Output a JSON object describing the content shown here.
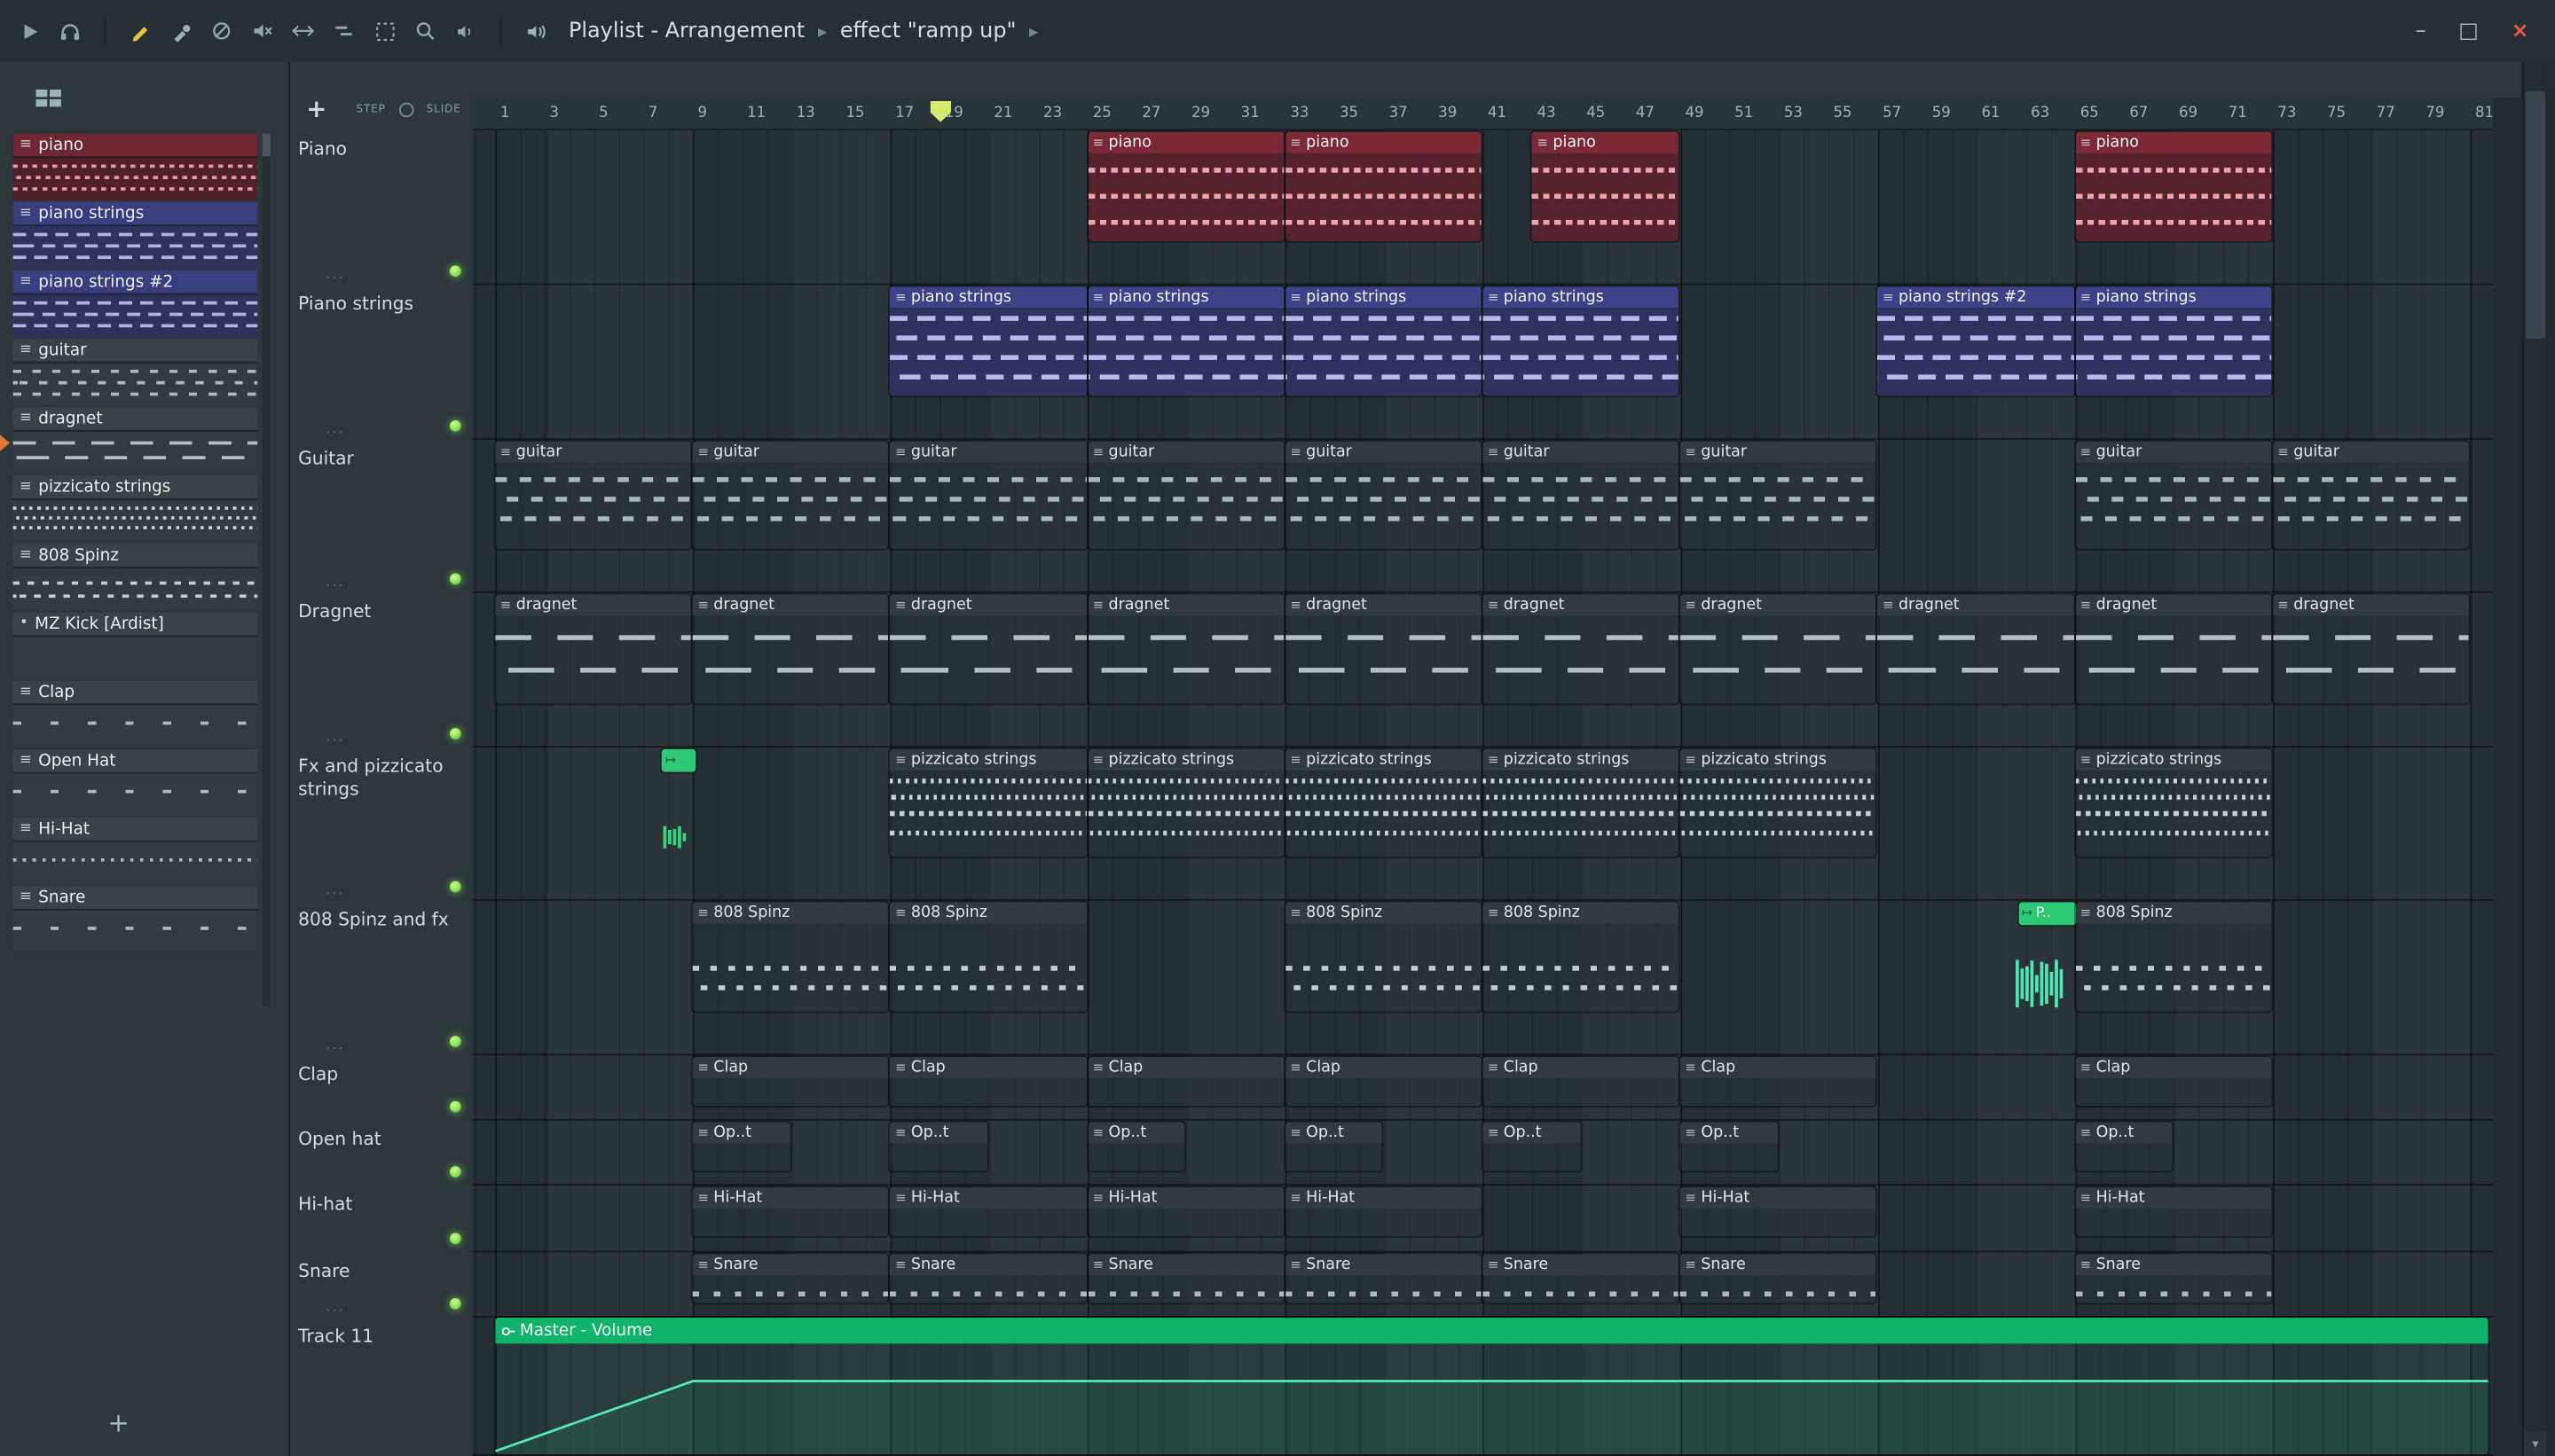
{
  "titlebar": {
    "breadcrumb": [
      "Playlist - Arrangement",
      "effect \"ramp up\""
    ],
    "window": {
      "minimize": "–",
      "maximize": "□",
      "close": "×"
    }
  },
  "playlist_controls": {
    "step_label": "STEP",
    "slide_label": "SLIDE",
    "add_label": "+"
  },
  "sidebar": {
    "add_label": "+",
    "items": [
      {
        "label": "piano",
        "color": "red",
        "preview": "p-piano"
      },
      {
        "label": "piano strings",
        "color": "indigo",
        "preview": "p-strings"
      },
      {
        "label": "piano strings #2",
        "color": "indigo",
        "preview": "p-strings"
      },
      {
        "label": "guitar",
        "color": "gray",
        "preview": "p-guitar"
      },
      {
        "label": "dragnet",
        "color": "gray",
        "preview": "p-dragnet",
        "playing": true
      },
      {
        "label": "pizzicato strings",
        "color": "gray",
        "preview": "p-pizz"
      },
      {
        "label": "808 Spinz",
        "color": "gray",
        "preview": "p-808"
      },
      {
        "label": "MZ Kick [Ardist]",
        "color": "gray",
        "preview": "p-empty",
        "bullet": true
      },
      {
        "label": "Clap",
        "color": "gray",
        "preview": "p-sparse"
      },
      {
        "label": "Open Hat",
        "color": "gray",
        "preview": "p-sparse"
      },
      {
        "label": "Hi-Hat",
        "color": "gray",
        "preview": "p-dots"
      },
      {
        "label": "Snare",
        "color": "gray",
        "preview": "p-sparse"
      }
    ]
  },
  "ruler": {
    "start": 1,
    "end": 81,
    "step": 2,
    "playhead_bar": 19
  },
  "tracks": [
    {
      "name": "Piano",
      "dots": true,
      "led": true
    },
    {
      "name": "Piano strings",
      "dots": true,
      "led": true
    },
    {
      "name": "Guitar",
      "dots": true,
      "led": true
    },
    {
      "name": "Dragnet",
      "dots": true,
      "led": true
    },
    {
      "name": "Fx and pizzicato strings",
      "dots": true,
      "led": true
    },
    {
      "name": "808 Spinz and fx",
      "dots": true,
      "led": true
    },
    {
      "name": "Clap",
      "dots": false,
      "led": true
    },
    {
      "name": "Open hat",
      "dots": false,
      "led": true
    },
    {
      "name": "Hi-hat",
      "dots": false,
      "led": true
    },
    {
      "name": "Snare",
      "dots": true,
      "led": true
    },
    {
      "name": "Track 11",
      "dots": false,
      "led": false
    }
  ],
  "clips": [
    {
      "t": 0,
      "s": 25,
      "e": 33,
      "k": "piano",
      "label": "piano"
    },
    {
      "t": 0,
      "s": 33,
      "e": 41,
      "k": "piano",
      "label": "piano"
    },
    {
      "t": 0,
      "s": 43,
      "e": 49,
      "k": "piano",
      "label": "piano"
    },
    {
      "t": 0,
      "s": 65,
      "e": 73,
      "k": "piano",
      "label": "piano"
    },
    {
      "t": 1,
      "s": 17,
      "e": 25,
      "k": "strings",
      "label": "piano strings"
    },
    {
      "t": 1,
      "s": 25,
      "e": 33,
      "k": "strings",
      "label": "piano strings"
    },
    {
      "t": 1,
      "s": 33,
      "e": 41,
      "k": "strings",
      "label": "piano strings"
    },
    {
      "t": 1,
      "s": 41,
      "e": 49,
      "k": "strings",
      "label": "piano strings"
    },
    {
      "t": 1,
      "s": 57,
      "e": 65,
      "k": "strings",
      "label": "piano strings #2"
    },
    {
      "t": 1,
      "s": 65,
      "e": 73,
      "k": "strings",
      "label": "piano strings"
    },
    {
      "t": 2,
      "s": 1,
      "e": 9,
      "k": "guitar",
      "label": "guitar"
    },
    {
      "t": 2,
      "s": 9,
      "e": 17,
      "k": "guitar",
      "label": "guitar"
    },
    {
      "t": 2,
      "s": 17,
      "e": 25,
      "k": "guitar",
      "label": "guitar"
    },
    {
      "t": 2,
      "s": 25,
      "e": 33,
      "k": "guitar",
      "label": "guitar"
    },
    {
      "t": 2,
      "s": 33,
      "e": 41,
      "k": "guitar",
      "label": "guitar"
    },
    {
      "t": 2,
      "s": 41,
      "e": 49,
      "k": "guitar",
      "label": "guitar"
    },
    {
      "t": 2,
      "s": 49,
      "e": 57,
      "k": "guitar",
      "label": "guitar"
    },
    {
      "t": 2,
      "s": 65,
      "e": 73,
      "k": "guitar",
      "label": "guitar"
    },
    {
      "t": 2,
      "s": 73,
      "e": 81,
      "k": "guitar",
      "label": "guitar"
    },
    {
      "t": 3,
      "s": 1,
      "e": 9,
      "k": "dragnet",
      "label": "dragnet"
    },
    {
      "t": 3,
      "s": 9,
      "e": 17,
      "k": "dragnet",
      "label": "dragnet"
    },
    {
      "t": 3,
      "s": 17,
      "e": 25,
      "k": "dragnet",
      "label": "dragnet"
    },
    {
      "t": 3,
      "s": 25,
      "e": 33,
      "k": "dragnet",
      "label": "dragnet"
    },
    {
      "t": 3,
      "s": 33,
      "e": 41,
      "k": "dragnet",
      "label": "dragnet"
    },
    {
      "t": 3,
      "s": 41,
      "e": 49,
      "k": "dragnet",
      "label": "dragnet"
    },
    {
      "t": 3,
      "s": 49,
      "e": 57,
      "k": "dragnet",
      "label": "dragnet"
    },
    {
      "t": 3,
      "s": 57,
      "e": 65,
      "k": "dragnet",
      "label": "dragnet"
    },
    {
      "t": 3,
      "s": 65,
      "e": 73,
      "k": "dragnet",
      "label": "dragnet"
    },
    {
      "t": 3,
      "s": 73,
      "e": 81,
      "k": "dragnet",
      "label": "dragnet"
    },
    {
      "t": 4,
      "s": 7.75,
      "e": 8.9,
      "k": "fxclip",
      "label": ""
    },
    {
      "t": 4,
      "s": 7.75,
      "e": 8.9,
      "k": "fxwave",
      "label": ""
    },
    {
      "t": 4,
      "s": 17,
      "e": 25,
      "k": "pizz",
      "label": "pizzicato strings"
    },
    {
      "t": 4,
      "s": 25,
      "e": 33,
      "k": "pizz",
      "label": "pizzicato strings"
    },
    {
      "t": 4,
      "s": 33,
      "e": 41,
      "k": "pizz",
      "label": "pizzicato strings"
    },
    {
      "t": 4,
      "s": 41,
      "e": 49,
      "k": "pizz",
      "label": "pizzicato strings"
    },
    {
      "t": 4,
      "s": 49,
      "e": 57,
      "k": "pizz",
      "label": "pizzicato strings"
    },
    {
      "t": 4,
      "s": 65,
      "e": 73,
      "k": "pizz",
      "label": "pizzicato strings"
    },
    {
      "t": 5,
      "s": 9,
      "e": 17,
      "k": "b808",
      "label": "808 Spinz"
    },
    {
      "t": 5,
      "s": 17,
      "e": 25,
      "k": "b808",
      "label": "808 Spinz"
    },
    {
      "t": 5,
      "s": 33,
      "e": 41,
      "k": "b808",
      "label": "808 Spinz"
    },
    {
      "t": 5,
      "s": 41,
      "e": 49,
      "k": "b808",
      "label": "808 Spinz"
    },
    {
      "t": 5,
      "s": 62.7,
      "e": 64.85,
      "k": "fxclip",
      "label": "P.."
    },
    {
      "t": 5,
      "s": 62.5,
      "e": 64.6,
      "k": "wave808",
      "label": ""
    },
    {
      "t": 5,
      "s": 65,
      "e": 73,
      "k": "b808",
      "label": "808 Spinz"
    },
    {
      "t": 6,
      "s": 9,
      "e": 17,
      "k": "clap",
      "label": "Clap"
    },
    {
      "t": 6,
      "s": 17,
      "e": 25,
      "k": "clap",
      "label": "Clap"
    },
    {
      "t": 6,
      "s": 25,
      "e": 33,
      "k": "clap",
      "label": "Clap"
    },
    {
      "t": 6,
      "s": 33,
      "e": 41,
      "k": "clap",
      "label": "Clap"
    },
    {
      "t": 6,
      "s": 41,
      "e": 49,
      "k": "clap",
      "label": "Clap"
    },
    {
      "t": 6,
      "s": 49,
      "e": 57,
      "k": "clap",
      "label": "Clap"
    },
    {
      "t": 6,
      "s": 65,
      "e": 73,
      "k": "clap",
      "label": "Clap"
    },
    {
      "t": 7,
      "s": 9,
      "e": 13,
      "k": "openhat",
      "label": "Op..t"
    },
    {
      "t": 7,
      "s": 17,
      "e": 21,
      "k": "openhat",
      "label": "Op..t"
    },
    {
      "t": 7,
      "s": 25,
      "e": 29,
      "k": "openhat",
      "label": "Op..t"
    },
    {
      "t": 7,
      "s": 33,
      "e": 37,
      "k": "openhat",
      "label": "Op..t"
    },
    {
      "t": 7,
      "s": 41,
      "e": 45,
      "k": "openhat",
      "label": "Op..t"
    },
    {
      "t": 7,
      "s": 49,
      "e": 53,
      "k": "openhat",
      "label": "Op..t"
    },
    {
      "t": 7,
      "s": 65,
      "e": 69,
      "k": "openhat",
      "label": "Op..t"
    },
    {
      "t": 8,
      "s": 9,
      "e": 17,
      "k": "hihat",
      "label": "Hi-Hat"
    },
    {
      "t": 8,
      "s": 17,
      "e": 25,
      "k": "hihat",
      "label": "Hi-Hat"
    },
    {
      "t": 8,
      "s": 25,
      "e": 33,
      "k": "hihat",
      "label": "Hi-Hat"
    },
    {
      "t": 8,
      "s": 33,
      "e": 41,
      "k": "hihat",
      "label": "Hi-Hat"
    },
    {
      "t": 8,
      "s": 49,
      "e": 57,
      "k": "hihat",
      "label": "Hi-Hat"
    },
    {
      "t": 8,
      "s": 65,
      "e": 73,
      "k": "hihat",
      "label": "Hi-Hat"
    },
    {
      "t": 9,
      "s": 9,
      "e": 17,
      "k": "snare",
      "label": "Snare"
    },
    {
      "t": 9,
      "s": 17,
      "e": 25,
      "k": "snare",
      "label": "Snare"
    },
    {
      "t": 9,
      "s": 25,
      "e": 33,
      "k": "snare",
      "label": "Snare"
    },
    {
      "t": 9,
      "s": 33,
      "e": 41,
      "k": "snare",
      "label": "Snare"
    },
    {
      "t": 9,
      "s": 41,
      "e": 49,
      "k": "snare",
      "label": "Snare"
    },
    {
      "t": 9,
      "s": 49,
      "e": 57,
      "k": "snare",
      "label": "Snare"
    },
    {
      "t": 9,
      "s": 65,
      "e": 73,
      "k": "snare",
      "label": "Snare"
    },
    {
      "t": 10,
      "s": 1,
      "e": 81.8,
      "k": "auto",
      "label": "Master - Volume"
    }
  ],
  "automation": {
    "label": "Master - Volume",
    "points": [
      {
        "bar": 1,
        "level": 0
      },
      {
        "bar": 9,
        "level": 1
      },
      {
        "bar": 82,
        "level": 1
      }
    ]
  },
  "colors": {
    "clip_red": "#7c2836",
    "clip_indigo": "#3e4186",
    "clip_gray": "#313a3f",
    "automation_green": "#10b36c",
    "audio_green": "#2ec977",
    "wave_teal": "#52e6b4",
    "led_green": "#8ee85e",
    "playhead": "#d8ea6e"
  }
}
